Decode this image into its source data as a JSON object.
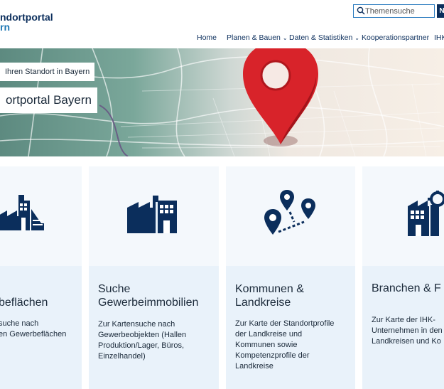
{
  "header": {
    "logo_line1": "ndortportal",
    "logo_line2": "rn",
    "search": {
      "placeholder": "Themensuche"
    },
    "search_button_label": "N"
  },
  "nav": {
    "items": [
      {
        "label": "Home",
        "has_dropdown": false
      },
      {
        "label": "Planen & Bauen",
        "has_dropdown": true
      },
      {
        "label": "Daten & Statistiken",
        "has_dropdown": true
      },
      {
        "label": "Kooperationspartner",
        "has_dropdown": false
      },
      {
        "label": "IHK",
        "has_dropdown": false
      }
    ]
  },
  "hero": {
    "tagline": "Ihren Standort in Bayern",
    "title": "ortportal Bayern"
  },
  "cards": [
    {
      "icon": "factory-icon",
      "title": "beflächen",
      "desc": [
        "suche nach",
        "en Gewerbeflächen"
      ]
    },
    {
      "icon": "factory-icon",
      "title": "Suche Gewerbeimmobilien",
      "title_lines": [
        "Suche",
        "Gewerbeimmobilien"
      ],
      "desc": [
        "Zur Kartensuche nach",
        "Gewerbeobjekten (Hallen",
        "Produktion/Lager, Büros,",
        "Einzelhandel)"
      ]
    },
    {
      "icon": "map-pins-icon",
      "title_lines": [
        "Kommunen &",
        "Landkreise"
      ],
      "desc": [
        "Zur Karte der Standortprofile",
        "der Landkreise und",
        "Kommunen sowie",
        "Kompetenzprofile der",
        "Landkreise"
      ]
    },
    {
      "icon": "industry-gear-icon",
      "title_lines": [
        "Branchen & F"
      ],
      "desc": [
        "Zur Karte der IHK-",
        "Unternehmen in den",
        "Landkreisen und Ko"
      ]
    }
  ],
  "colors": {
    "brand_dark": "#0b2e5c",
    "brand_light": "#1f78b4",
    "card_bg": "#e9f2fa",
    "pin_red": "#d8232a"
  }
}
